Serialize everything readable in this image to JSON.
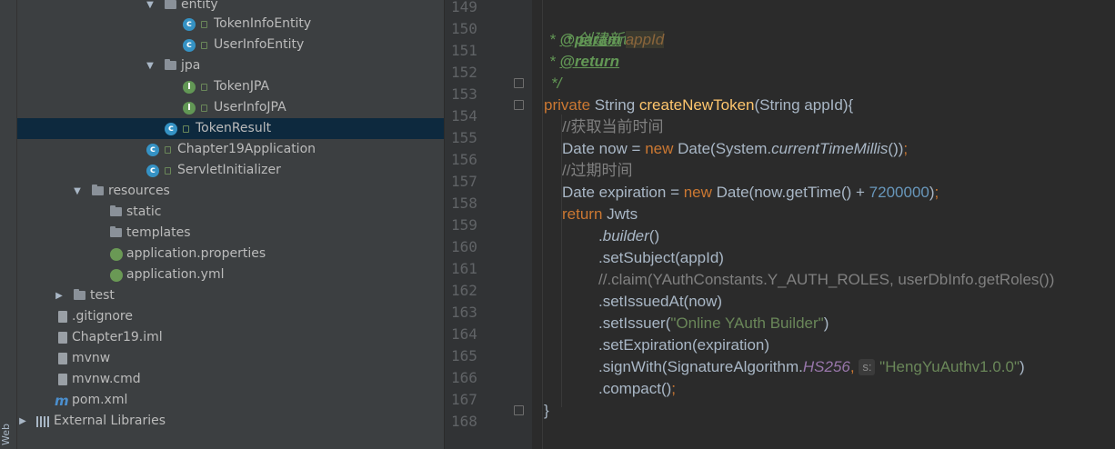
{
  "side_strip": {
    "label": "Web"
  },
  "tree": [
    {
      "label": "entity",
      "kind": "folder",
      "expanded": true
    },
    {
      "label": "TokenInfoEntity",
      "kind": "class"
    },
    {
      "label": "UserInfoEntity",
      "kind": "class"
    },
    {
      "label": "jpa",
      "kind": "folder",
      "expanded": true
    },
    {
      "label": "TokenJPA",
      "kind": "interface"
    },
    {
      "label": "UserInfoJPA",
      "kind": "interface"
    },
    {
      "label": "TokenResult",
      "kind": "class",
      "selected": true
    },
    {
      "label": "Chapter19Application",
      "kind": "spring-class"
    },
    {
      "label": "ServletInitializer",
      "kind": "class"
    },
    {
      "label": "resources",
      "kind": "resources-folder",
      "expanded": true
    },
    {
      "label": "static",
      "kind": "folder"
    },
    {
      "label": "templates",
      "kind": "folder"
    },
    {
      "label": "application.properties",
      "kind": "spring-config"
    },
    {
      "label": "application.yml",
      "kind": "spring-config"
    },
    {
      "label": "test",
      "kind": "folder",
      "expanded": false
    },
    {
      "label": ".gitignore",
      "kind": "file"
    },
    {
      "label": "Chapter19.iml",
      "kind": "file"
    },
    {
      "label": "mvnw",
      "kind": "file"
    },
    {
      "label": "mvnw.cmd",
      "kind": "file"
    },
    {
      "label": "pom.xml",
      "kind": "maven"
    },
    {
      "label": "External Libraries",
      "kind": "libraries",
      "expanded": false
    }
  ],
  "line_numbers": [
    "149",
    "150",
    "151",
    "152",
    "153",
    "154",
    "155",
    "156",
    "157",
    "158",
    "159",
    "160",
    "161",
    "162",
    "163",
    "164",
    "165",
    "166",
    "167",
    "168"
  ],
  "code": {
    "l149": "* 创建新token",
    "l150_star": "* ",
    "l150_tag": "@param",
    "l150_name": "appId",
    "l151_star": "* ",
    "l151_tag": "@return",
    "l152": "*/",
    "l153_kw": "private ",
    "l153_type": "String ",
    "l153_fn": "createNewToken",
    "l153_rest": "(String appId){",
    "l154": "//获取当前时间",
    "l155_a": "Date now = ",
    "l155_kw": "new ",
    "l155_b": "Date(System.",
    "l155_static": "currentTimeMillis",
    "l155_c": "())",
    "l155_semi": ";",
    "l156": "//过期时间",
    "l157_a": "Date expiration = ",
    "l157_kw": "new ",
    "l157_b": "Date(now.getTime() + ",
    "l157_num": "7200000",
    "l157_c": ")",
    "l157_semi": ";",
    "l158_kw": "return ",
    "l158_b": "Jwts",
    "l159_a": ".",
    "l159_static": "builder",
    "l159_b": "()",
    "l160": ".setSubject(appId)",
    "l161": "//.claim(YAuthConstants.Y_AUTH_ROLES, userDbInfo.getRoles())",
    "l162": ".setIssuedAt(now)",
    "l163_a": ".setIssuer(",
    "l163_str": "\"Online YAuth Builder\"",
    "l163_b": ")",
    "l164": ".setExpiration(expiration)",
    "l165_a": ".signWith(SignatureAlgorithm.",
    "l165_const": "HS256",
    "l165_comma": ", ",
    "l165_hint": "s:",
    "l165_str": "\"HengYuAuthv1.0.0\"",
    "l165_b": ")",
    "l166_a": ".compact()",
    "l166_semi": ";",
    "l167": "}",
    "l168": "}"
  },
  "colors": {
    "tree_bg": "#3c3f41",
    "editor_bg": "#2b2b2b",
    "gutter_bg": "#313335",
    "selection": "#0d293e",
    "keyword": "#cc7832",
    "method": "#ffc66d",
    "number": "#6897bb",
    "string": "#6a8759",
    "comment": "#808080",
    "doc_comment": "#629755"
  }
}
